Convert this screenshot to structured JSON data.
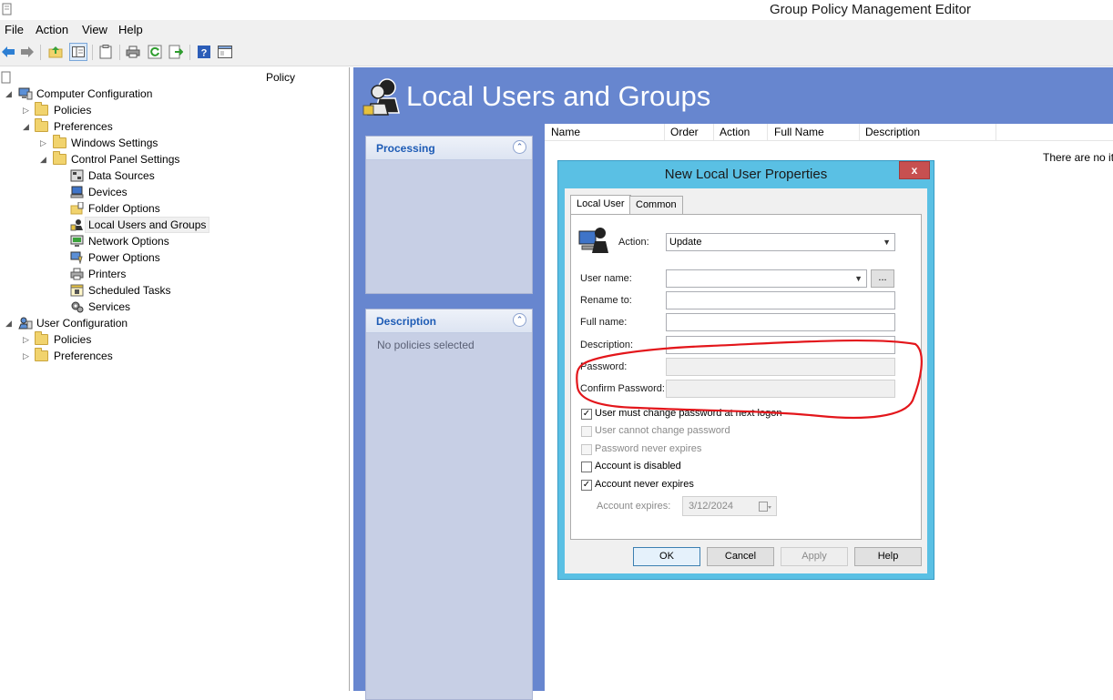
{
  "window": {
    "title": "Group Policy Management Editor"
  },
  "menu": [
    "File",
    "Action",
    "View",
    "Help"
  ],
  "toolbar": {
    "icons": [
      "back-arrow-icon",
      "forward-arrow-icon",
      "up-folder-icon",
      "show-hide-tree-icon",
      "clipboard-icon",
      "print-icon",
      "refresh-icon",
      "export-list-icon",
      "help-icon",
      "properties-icon"
    ]
  },
  "tree": {
    "root_label": "Policy",
    "nodes": [
      {
        "label": "Computer Configuration"
      },
      {
        "label": "Policies"
      },
      {
        "label": "Preferences"
      },
      {
        "label": "Windows Settings"
      },
      {
        "label": "Control Panel Settings"
      },
      {
        "label": "Data Sources"
      },
      {
        "label": "Devices"
      },
      {
        "label": "Folder Options"
      },
      {
        "label": "Local Users and Groups"
      },
      {
        "label": "Network Options"
      },
      {
        "label": "Power Options"
      },
      {
        "label": "Printers"
      },
      {
        "label": "Scheduled Tasks"
      },
      {
        "label": "Services"
      },
      {
        "label": "User Configuration"
      },
      {
        "label": "Policies"
      },
      {
        "label": "Preferences"
      }
    ]
  },
  "banner": {
    "title": "Local Users and Groups"
  },
  "panels": {
    "processing": {
      "title": "Processing"
    },
    "description": {
      "title": "Description",
      "body": "No policies selected"
    }
  },
  "list": {
    "columns": [
      "Name",
      "Order",
      "Action",
      "Full Name",
      "Description"
    ],
    "empty_text": "There are no it"
  },
  "dialog": {
    "title": "New Local User Properties",
    "close_label": "x",
    "tabs": [
      "Local User",
      "Common"
    ],
    "action_label": "Action:",
    "action_value": "Update",
    "browse_label": "...",
    "fields": {
      "user_name": "User name:",
      "rename_to": "Rename to:",
      "full_name": "Full name:",
      "description": "Description:",
      "password": "Password:",
      "confirm_password": "Confirm Password:"
    },
    "checks": {
      "must_change": "User must change password at next logon",
      "cannot_change": "User cannot change password",
      "never_expires_pw": "Password never expires",
      "disabled": "Account is disabled",
      "never_expires_acct": "Account never expires"
    },
    "account_expires_label": "Account expires:",
    "account_expires_value": "3/12/2024",
    "buttons": {
      "ok": "OK",
      "cancel": "Cancel",
      "apply": "Apply",
      "help": "Help"
    }
  },
  "annotation": {
    "color": "#e3161b"
  }
}
